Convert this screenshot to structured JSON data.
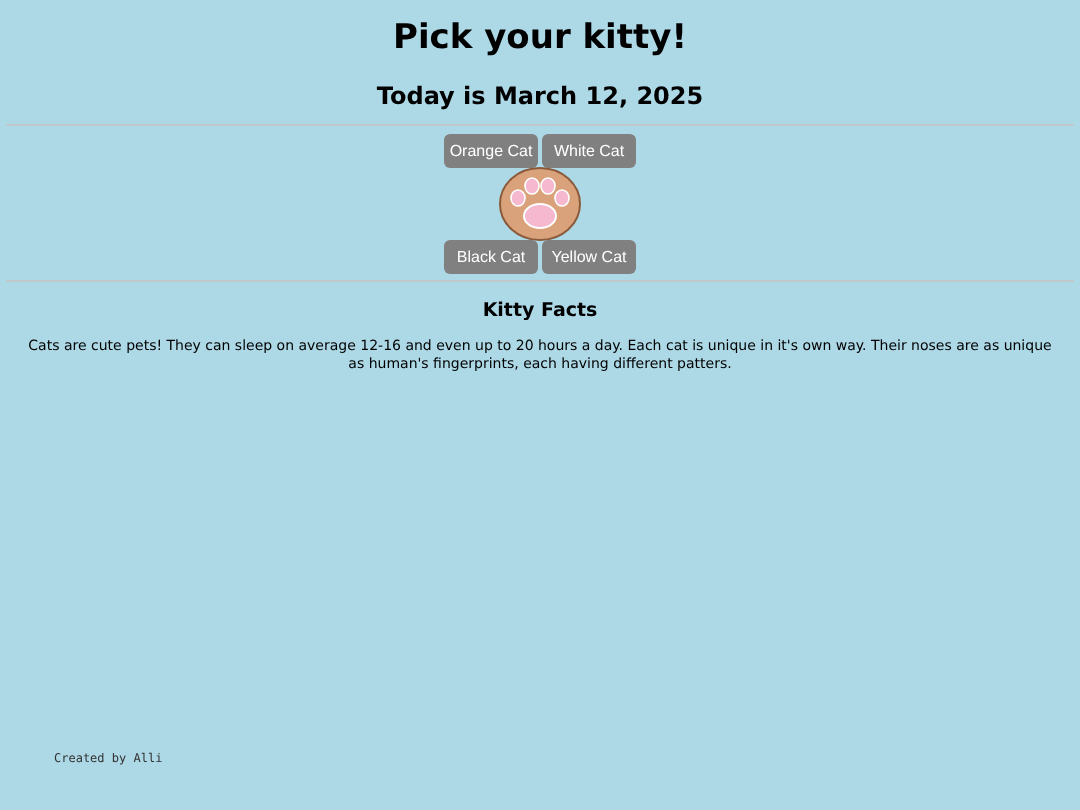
{
  "title": "Pick your kitty!",
  "date": "Today is March 12, 2025",
  "top_buttons": [
    "Orange Cat",
    "White Cat"
  ],
  "bottom_buttons": [
    "Black Cat",
    "Yellow Cat"
  ],
  "facts": {
    "heading": "Kitty Facts",
    "text": "Cats are cute pets! They can sleep on average 12-16 and even up to 20 hours a day. Each cat is unique in it's own way. Their noses are as unique as human's fingerprints, each having different patters."
  },
  "footer": "Created by Alli"
}
